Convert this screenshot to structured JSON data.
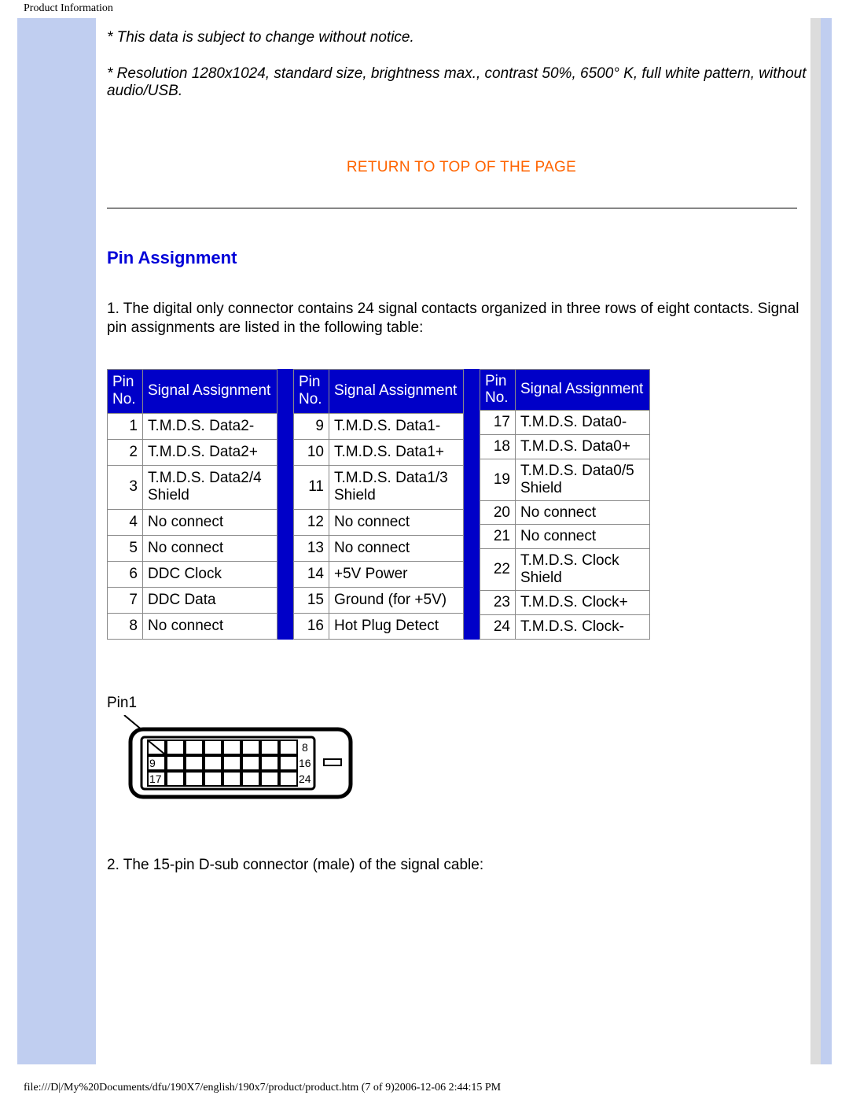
{
  "header": {
    "pathTitle": "Product Information"
  },
  "notes": {
    "note1": "* This data is subject to change without notice.",
    "note2": "* Resolution 1280x1024, standard size, brightness max., contrast 50%, 6500° K, full white pattern, without audio/USB."
  },
  "returnLink": "RETURN TO TOP OF THE PAGE",
  "pinSection": {
    "title": "Pin Assignment",
    "intro": "1. The digital only connector contains 24 signal contacts organized in three rows of eight contacts. Signal pin assignments are listed in the following table:",
    "headers": {
      "pin": "Pin No.",
      "signal": "Signal Assignment"
    },
    "columns": [
      {
        "rows": [
          {
            "no": "1",
            "sig": "T.M.D.S. Data2-"
          },
          {
            "no": "2",
            "sig": "T.M.D.S. Data2+"
          },
          {
            "no": "3",
            "sig": "T.M.D.S. Data2/4 Shield"
          },
          {
            "no": "4",
            "sig": "No connect"
          },
          {
            "no": "5",
            "sig": "No connect"
          },
          {
            "no": "6",
            "sig": "DDC Clock"
          },
          {
            "no": "7",
            "sig": "DDC Data"
          },
          {
            "no": "8",
            "sig": "No connect"
          }
        ]
      },
      {
        "rows": [
          {
            "no": "9",
            "sig": "T.M.D.S. Data1-"
          },
          {
            "no": "10",
            "sig": "T.M.D.S. Data1+"
          },
          {
            "no": "11",
            "sig": "T.M.D.S. Data1/3 Shield"
          },
          {
            "no": "12",
            "sig": "No connect"
          },
          {
            "no": "13",
            "sig": "No connect"
          },
          {
            "no": "14",
            "sig": "+5V Power"
          },
          {
            "no": "15",
            "sig": "Ground (for +5V)"
          },
          {
            "no": "16",
            "sig": "Hot Plug Detect"
          }
        ]
      },
      {
        "rows": [
          {
            "no": "17",
            "sig": "T.M.D.S. Data0-"
          },
          {
            "no": "18",
            "sig": "T.M.D.S. Data0+"
          },
          {
            "no": "19",
            "sig": "T.M.D.S. Data0/5 Shield"
          },
          {
            "no": "20",
            "sig": "No connect"
          },
          {
            "no": "21",
            "sig": "No connect"
          },
          {
            "no": "22",
            "sig": "T.M.D.S. Clock Shield"
          },
          {
            "no": "23",
            "sig": "T.M.D.S. Clock+"
          },
          {
            "no": "24",
            "sig": "T.M.D.S. Clock-"
          }
        ]
      }
    ],
    "diagram": {
      "pin1Label": "Pin1",
      "labels": {
        "tr": "8",
        "ml": "9",
        "mr": "16",
        "bl": "17",
        "br": "24"
      }
    },
    "subNote": "2. The 15-pin D-sub connector (male) of the signal cable:"
  },
  "footer": {
    "path": "file:///D|/My%20Documents/dfu/190X7/english/190x7/product/product.htm (7 of 9)2006-12-06 2:44:15 PM"
  }
}
